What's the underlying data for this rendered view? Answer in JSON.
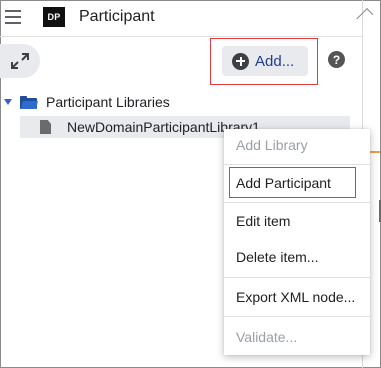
{
  "header": {
    "logo_text": "DP",
    "title": "Participant"
  },
  "toolbar": {
    "add_label": "Add...",
    "help_label": "?"
  },
  "tree": {
    "root_label": "Participant Libraries",
    "child_label": "NewDomainParticipantLibrary1"
  },
  "context_menu": {
    "items": [
      {
        "label": "Add Library",
        "enabled": false
      },
      {
        "label": "Add Participant",
        "enabled": true,
        "highlighted": true
      },
      {
        "label": "Edit item",
        "enabled": true
      },
      {
        "label": "Delete item...",
        "enabled": true
      },
      {
        "label": "Export XML node...",
        "enabled": true
      },
      {
        "label": "Validate...",
        "enabled": false
      }
    ]
  },
  "colors": {
    "highlight_border": "#e0393e",
    "add_label": "#1f3a93",
    "folder": "#1f4e9c",
    "disabled_text": "#9aa0a6"
  },
  "icons": [
    "menu-icon",
    "expand-icon",
    "plus-circle-icon",
    "help-icon",
    "caret-down-icon",
    "folder-open-icon",
    "document-icon"
  ]
}
